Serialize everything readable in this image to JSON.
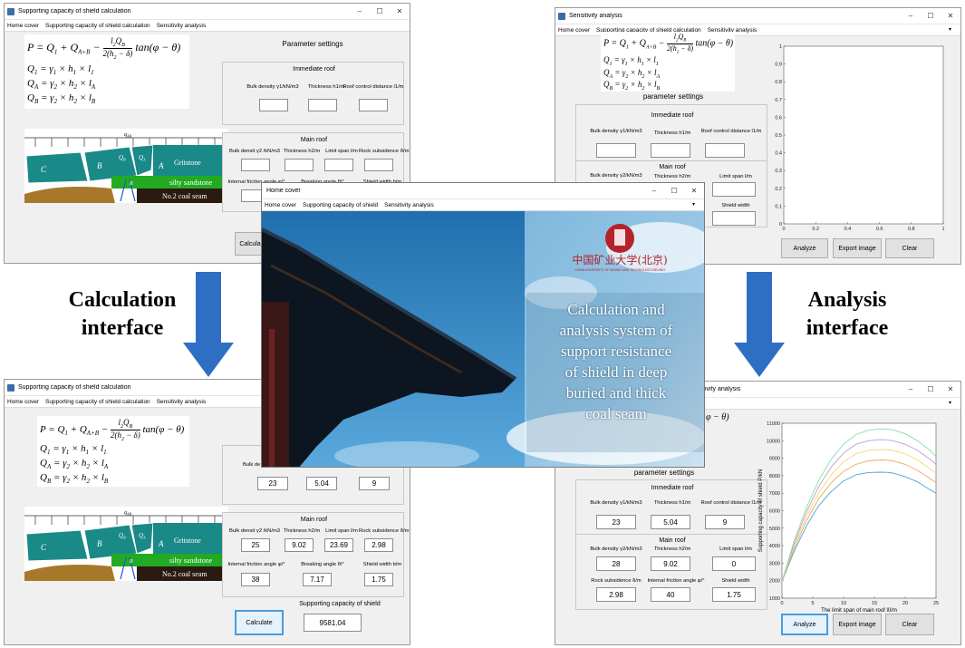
{
  "labels": {
    "calc_line1": "Calculation",
    "calc_line2": "interface",
    "analysis_line1": "Analysis",
    "analysis_line2": "interface"
  },
  "menus": {
    "home": "Home cover",
    "calc": "Supporting capacity of shield calculation",
    "calc_short": "Supporting capacity of shield",
    "sens": "Sensitivity analysis"
  },
  "win_tl": {
    "title": "Supporting capacity of shield calculation",
    "param_title": "Parameter settings",
    "immediate_roof": "Immediate roof",
    "main_roof": "Main roof",
    "f_bulk1": "Bulk density γ1/kN/m3",
    "f_thick1": "Thickness h1/m",
    "f_rcd": "Roof control distance l1/m",
    "f_bulk2": "Bulk densit γ2 /kN/m3",
    "f_thick2": "Thickness h2/m",
    "f_span": "Limit span l/m",
    "f_sub": "Rock subsidence δ/m",
    "f_fric": "Internal friction angle φ/°",
    "f_break": "Breaking angle θ/°",
    "f_width": "Shield width b/m",
    "calc_btn": "Calcula"
  },
  "diagram": {
    "q": "q",
    "q_sub": "AB",
    "lbl_c": "C",
    "lbl_b": "B",
    "lbl_qb": "Q",
    "lbl_qb_sub": "B",
    "lbl_qa": "Q",
    "lbl_qa_sub": "A",
    "lbl_a": "A",
    "lbl_p": "P",
    "lbl_r": "R",
    "gritstone": "Gritstone",
    "silty": "silty sandstone",
    "coal": "No.2 coal seam"
  },
  "win_bl": {
    "title": "Supporting capacity of shield calculation",
    "main_roof": "Main roof",
    "partial_label": "Bulk de",
    "f_bulk2": "Bulk densit γ2 /kN/m3",
    "f_thick2": "Thickness h2/m",
    "f_span": "Limit span l/m",
    "f_sub": "Rock subsidence δ/m",
    "f_fric": "Internal friction angle φ/°",
    "f_break": "Breaking angle θ/°",
    "f_width": "Shield width b/m",
    "v_bulk1": "23",
    "v_thick1": "5.04",
    "v_rcd": "9",
    "v_bulk2": "25",
    "v_thick2": "9.02",
    "v_span": "23.69",
    "v_sub": "2.98",
    "v_fric": "38",
    "v_break": "7.17",
    "v_width": "1.75",
    "result_label": "Supporting capacity of shield",
    "result_value": "9581.04",
    "calc_btn": "Calculate"
  },
  "win_tr": {
    "title": "Sensitivity analysis",
    "param_title": "parameter settings",
    "immediate_roof": "Immediate roof",
    "main_roof": "Main roof",
    "f_bulk1": "Bulk density γ1/kN/m3",
    "f_thick1": "Thickness h1/m",
    "f_rcd": "Roof control distance l1/m",
    "f_bulk2": "Bulk density γ2/kN/m3",
    "f_thick2": "Thickness h2/m",
    "f_span": "Limit span l/m",
    "f_width": "Shield width",
    "analyze": "Analyze",
    "export": "Export image",
    "clear": "Clear"
  },
  "win_br": {
    "title_tail": "ivity analysis",
    "param_title": "parameter settings",
    "immediate_roof": "Immediate roof",
    "main_roof": "Main roof",
    "f_bulk1": "Bulk density γ1/kN/m3",
    "f_thick1": "Thickness h1/m",
    "f_rcd": "Roof control distance l1/m",
    "f_bulk2": "Bulk density γ2/kN/m3",
    "f_thick2": "Thickness h2/m",
    "f_span": "Limit span l/m",
    "f_sub": "Rock subsidence δ/m",
    "f_fric": "Internal friction angle φ/°",
    "f_width": "Shield width",
    "v_bulk1": "23",
    "v_thick1": "5.04",
    "v_rcd": "9",
    "v_bulk2": "28",
    "v_thick2": "9.02",
    "v_span": "0",
    "v_sub": "2.98",
    "v_fric": "40",
    "v_width": "1.75",
    "analyze": "Analyze",
    "export": "Export image",
    "clear": "Clear",
    "formula_tail": "φ − θ)"
  },
  "home": {
    "title": "Home cover",
    "logo_cn": "中国矿业大学(北京)",
    "logo_en": "CHINA UNIVERSITY OF MINING AND TECHNOLOGY-BEIJING",
    "headline": [
      "Calculation and",
      "analysis system of",
      "support resistance",
      "of shield in deep",
      "buried and thick",
      "coal seam"
    ]
  },
  "chart_data": [
    {
      "type": "line",
      "title": "",
      "xlabel": "",
      "ylabel": "",
      "xlim": [
        0,
        1
      ],
      "ylim": [
        0,
        1
      ],
      "xticks": [
        "0",
        "0.2",
        "0.4",
        "0.6",
        "0.8",
        "1"
      ],
      "yticks": [
        "0",
        "0.1",
        "0.2",
        "0.3",
        "0.4",
        "0.5",
        "0.6",
        "0.7",
        "0.8",
        "0.9",
        "1"
      ],
      "series": []
    },
    {
      "type": "line",
      "title": "",
      "xlabel": "The limit span of main roof l0/m",
      "ylabel": "Supporting capacity of shield P/kN",
      "xlim": [
        0,
        25
      ],
      "ylim": [
        1000,
        11000
      ],
      "xticks": [
        "0",
        "5",
        "10",
        "15",
        "20",
        "25"
      ],
      "yticks": [
        "1000",
        "2000",
        "3000",
        "4000",
        "5000",
        "6000",
        "7000",
        "8000",
        "9000",
        "10000",
        "11000"
      ],
      "x": [
        0,
        2,
        4,
        6,
        8,
        10,
        12,
        14,
        16,
        17,
        18,
        20,
        22,
        24,
        25
      ],
      "series": [
        {
          "color": "#4aa3df",
          "values": [
            1950,
            3700,
            5150,
            6300,
            7100,
            7700,
            8050,
            8180,
            8200,
            8190,
            8150,
            7950,
            7650,
            7200,
            7000
          ]
        },
        {
          "color": "#f2a65a",
          "values": [
            1950,
            3850,
            5450,
            6700,
            7600,
            8250,
            8650,
            8850,
            8900,
            8890,
            8850,
            8650,
            8300,
            7850,
            7600
          ]
        },
        {
          "color": "#f5d76e",
          "values": [
            1950,
            4000,
            5700,
            7050,
            8050,
            8800,
            9250,
            9450,
            9500,
            9490,
            9450,
            9250,
            8900,
            8400,
            8150
          ]
        },
        {
          "color": "#c39bd3",
          "values": [
            1950,
            4150,
            5950,
            7400,
            8500,
            9300,
            9800,
            10000,
            10060,
            10050,
            10000,
            9800,
            9450,
            8950,
            8650
          ]
        },
        {
          "color": "#82e0aa",
          "values": [
            1950,
            4300,
            6200,
            7750,
            8950,
            9800,
            10350,
            10600,
            10680,
            10670,
            10620,
            10400,
            10000,
            9450,
            9100
          ]
        }
      ]
    }
  ]
}
